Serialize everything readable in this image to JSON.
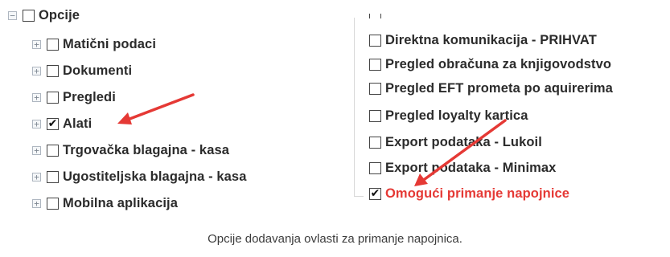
{
  "left_tree": {
    "root": {
      "label": "Opcije",
      "checked": false,
      "expander": "−"
    },
    "items": [
      {
        "label": "Matični podaci",
        "checked": false,
        "expander": "+"
      },
      {
        "label": "Dokumenti",
        "checked": false,
        "expander": "+"
      },
      {
        "label": "Pregledi",
        "checked": false,
        "expander": "+"
      },
      {
        "label": "Alati",
        "checked": true,
        "expander": "+"
      },
      {
        "label": "Trgovačka blagajna - kasa",
        "checked": false,
        "expander": "+"
      },
      {
        "label": "Ugostiteljska blagajna - kasa",
        "checked": false,
        "expander": "+"
      },
      {
        "label": "Mobilna aplikacija",
        "checked": false,
        "expander": "+"
      }
    ]
  },
  "right_tree": {
    "items": [
      {
        "label": "Direktna komunikacija - PRIHVAT",
        "checked": false
      },
      {
        "label": "Pregled obračuna za knjigovodstvo",
        "checked": false
      },
      {
        "label": "Pregled EFT prometa po aquirerima",
        "checked": false
      },
      {
        "label": "Pregled loyalty kartica",
        "checked": false
      },
      {
        "label": "Export podataka - Lukoil",
        "checked": false
      },
      {
        "label": "Export podataka - Minimax",
        "checked": false
      },
      {
        "label": "Omogući primanje napojnice",
        "checked": true,
        "highlight": true
      }
    ]
  },
  "check_glyph": "✔",
  "caption": "Opcije dodavanja ovlasti za primanje napojnica.",
  "colors": {
    "highlight": "#e53935",
    "arrow": "#e53935",
    "text": "#2b2b2b"
  },
  "icons": [
    "expand-icon",
    "collapse-icon",
    "checkbox",
    "checkmark-icon",
    "arrow-annotation"
  ]
}
